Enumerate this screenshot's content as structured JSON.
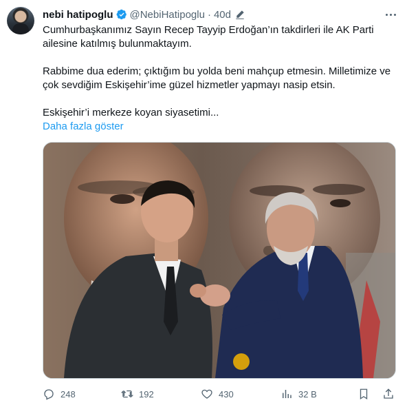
{
  "author": {
    "name": "nebi hatipoglu",
    "handle": "@NebiHatipoglu",
    "separator": "·",
    "time": "40d"
  },
  "tweet": {
    "paragraph1": "Cumhurbaşkanımız Sayın Recep Tayyip Erdoğan’ın takdirleri ile AK Parti ailesine katılmış bulunmaktayım.",
    "paragraph2": "Rabbime dua ederim; çıktığım bu yolda beni mahçup etmesin. Milletimize ve çok sevdiğim Eskişehir’ime güzel hizmetler yapmayı nasip etsin.",
    "paragraph3": "Eskişehir’i merkeze koyan siyasetimi...",
    "show_more": "Daha fazla göster"
  },
  "actions": {
    "replies": "248",
    "retweets": "192",
    "likes": "430",
    "views": "32 B"
  },
  "colors": {
    "accent": "#1d9bf0",
    "muted": "#536471"
  }
}
